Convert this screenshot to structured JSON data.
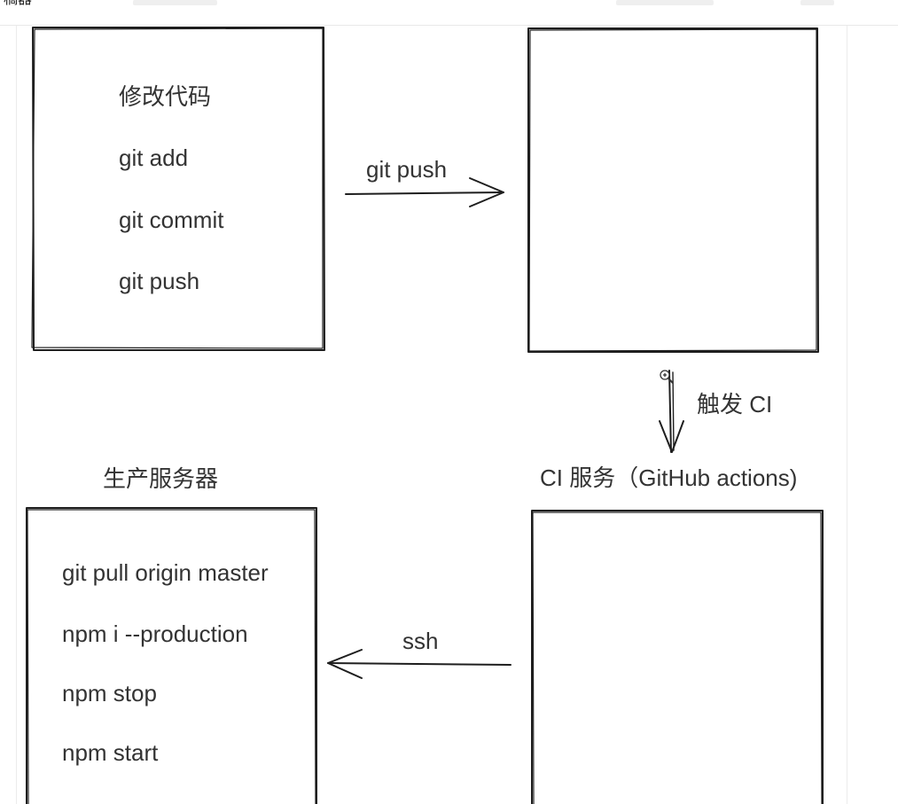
{
  "header": {
    "left_fragment": "稿器"
  },
  "boxes": {
    "developer": {
      "steps": [
        "修改代码",
        "git add",
        "git commit",
        "git push"
      ]
    },
    "repo": {},
    "ci": {
      "title": "CI 服务（GitHub actions)"
    },
    "server": {
      "title": "生产服务器",
      "steps": [
        "git pull origin master",
        "npm i --production",
        "npm stop",
        "npm start"
      ]
    }
  },
  "arrows": {
    "push": "git push",
    "trigger": "触发 CI",
    "ssh": "ssh"
  },
  "colors": {
    "stroke": "#1e1e1e",
    "text": "#333333"
  }
}
